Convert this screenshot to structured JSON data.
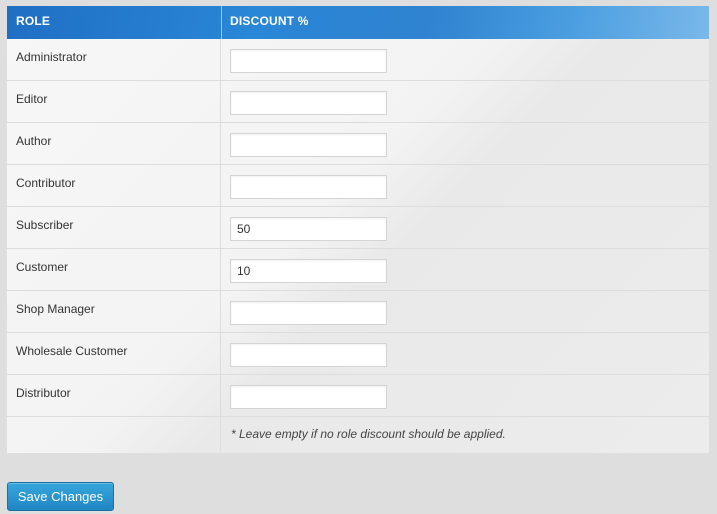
{
  "table": {
    "headers": {
      "role": "ROLE",
      "discount": "DISCOUNT %"
    },
    "rows": [
      {
        "role": "Administrator",
        "value": ""
      },
      {
        "role": "Editor",
        "value": ""
      },
      {
        "role": "Author",
        "value": ""
      },
      {
        "role": "Contributor",
        "value": ""
      },
      {
        "role": "Subscriber",
        "value": "50"
      },
      {
        "role": "Customer",
        "value": "10"
      },
      {
        "role": "Shop Manager",
        "value": ""
      },
      {
        "role": "Wholesale Customer",
        "value": ""
      },
      {
        "role": "Distributor",
        "value": ""
      }
    ],
    "note": "* Leave empty if no role discount should be applied."
  },
  "actions": {
    "save_label": "Save Changes"
  },
  "colors": {
    "header": "#2a86d6",
    "button": "#2a96d0",
    "background": "#dedede"
  }
}
